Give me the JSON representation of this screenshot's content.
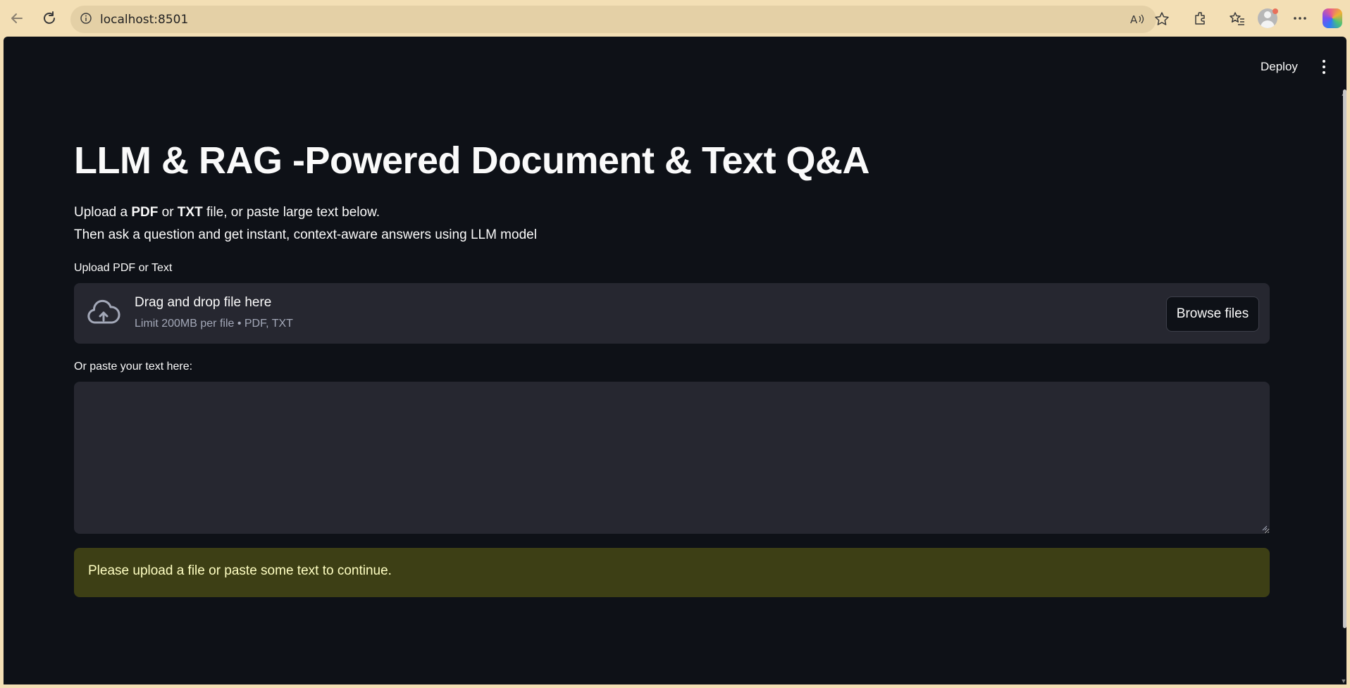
{
  "browser": {
    "url": "localhost:8501",
    "icons": [
      "back-arrow-icon",
      "refresh-icon",
      "info-icon",
      "read-aloud-icon",
      "favorite-star-icon",
      "extensions-icon",
      "favorites-icon",
      "profile-avatar",
      "more-icon",
      "copilot-icon"
    ]
  },
  "header": {
    "deploy_label": "Deploy"
  },
  "page": {
    "title": "LLM & RAG -Powered Document & Text Q&A",
    "desc_line1_a": "Upload a ",
    "desc_line1_pdf": "PDF",
    "desc_line1_b": " or ",
    "desc_line1_txt": "TXT",
    "desc_line1_c": " file, or paste large text below.",
    "desc_line2": "Then ask a question and get instant, context-aware answers using LLM model"
  },
  "uploader": {
    "label": "Upload PDF or Text",
    "drag_text": "Drag and drop file here",
    "limit_text": "Limit 200MB per file • PDF, TXT",
    "browse_label": "Browse files"
  },
  "paste": {
    "label": "Or paste your text here:",
    "value": ""
  },
  "alert": {
    "text": "Please upload a file or paste some text to continue.",
    "bg_color": "#3d3f15",
    "text_color": "#ffffc2"
  },
  "colors": {
    "app_bg": "#0e1117",
    "widget_bg": "#262730",
    "browser_chrome": "#f3dfb5"
  }
}
